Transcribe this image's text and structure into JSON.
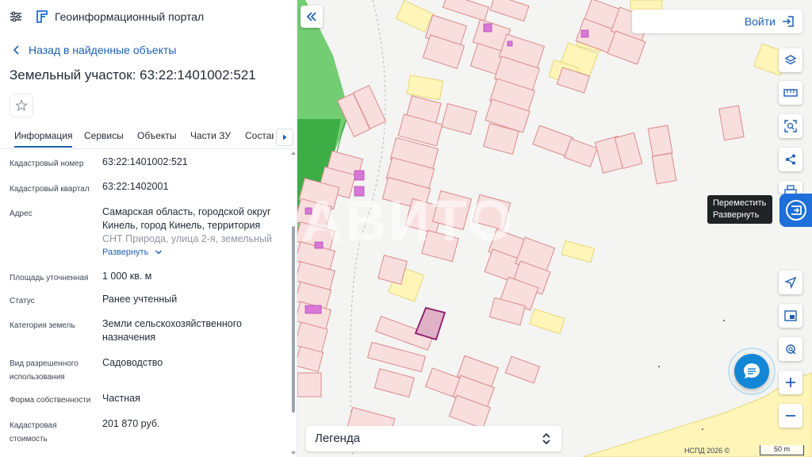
{
  "header": {
    "app_title": "Геоинформационный портал"
  },
  "nav": {
    "back_label": "Назад в найденные объекты"
  },
  "object": {
    "title": "Земельный участок: 63:22:1401002:521"
  },
  "tabs": [
    {
      "label": "Информация",
      "active": true
    },
    {
      "label": "Сервисы"
    },
    {
      "label": "Объекты"
    },
    {
      "label": "Части ЗУ"
    },
    {
      "label": "Состав"
    }
  ],
  "details": {
    "cadastral_number": {
      "label": "Кадастровый номер",
      "value": "63:22:1401002:521"
    },
    "cadastral_quarter": {
      "label": "Кадастровый квартал",
      "value": "63:22:1402001"
    },
    "address": {
      "label": "Адрес",
      "line1": "Самарская область, городской округ",
      "line2": "Кинель, город Кинель, территория",
      "line3": "СНТ Природа, улица 2-я, земельный",
      "expand_label": "Развернуть"
    },
    "area": {
      "label": "Площадь уточненная",
      "value": "1 000 кв. м"
    },
    "status": {
      "label": "Статус",
      "value": "Ранее учтенный"
    },
    "land_category": {
      "label": "Категория земель",
      "value_line1": "Земли сельскохозяйственного",
      "value_line2": "назначения"
    },
    "permitted_use": {
      "label_line1": "Вид разрешенного",
      "label_line2": "использования",
      "value": "Садоводство"
    },
    "ownership": {
      "label": "Форма собственности",
      "value": "Частная"
    },
    "cadastral_value": {
      "label_line1": "Кадастровая",
      "label_line2": "стоимость",
      "value": "201 870 руб."
    }
  },
  "map": {
    "login_label": "Войти",
    "tooltip_line1": "Переместить",
    "tooltip_line2": "Развернуть",
    "legend_label": "Легенда",
    "copyright": "НСПД 2026 ©",
    "scale_label": "50 m",
    "watermark": "АВИТО"
  },
  "colors": {
    "accent": "#1e5fb3",
    "parcel_fill": "#f9dede",
    "parcel_stroke": "#d98a8a",
    "selected_stroke": "#8b1a6b",
    "building_fill": "#fff5b8",
    "greenery": "#3fbf3f"
  },
  "icons": {
    "menu": "sliders-icon",
    "logo": "logo-icon",
    "back": "chevron-left-icon",
    "favorite": "star-icon",
    "collapse": "double-chevron-left-icon",
    "login": "login-icon",
    "layers": "layers-icon",
    "ruler": "ruler-icon",
    "select": "select-area-icon",
    "share": "share-icon",
    "print": "print-icon",
    "move": "move-panel-icon",
    "navigate": "navigation-icon",
    "minimap": "minimap-icon",
    "geolocate": "locate-icon",
    "zoom_in": "plus-icon",
    "zoom_out": "minus-icon",
    "chat": "chat-icon"
  }
}
